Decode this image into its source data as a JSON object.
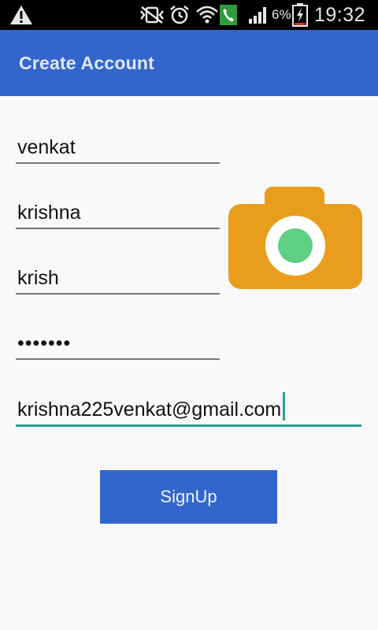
{
  "status_bar": {
    "time": "19:32",
    "battery_percent": "6%",
    "icons": [
      "warning-icon",
      "vibrate-muted-icon",
      "alarm-icon",
      "wifi-icon",
      "call-icon",
      "signal-icon",
      "battery-charging-icon"
    ]
  },
  "app_bar": {
    "title": "Create Account"
  },
  "form": {
    "first_name": "venkat",
    "last_name": "krishna",
    "username": "krish",
    "password_masked": "•••••••",
    "email": "krishna225venkat@gmail.com",
    "submit_label": "SignUp"
  },
  "photo": {
    "icon": "camera-icon",
    "body_color": "#e89e1c",
    "lens_color": "#5ecf85"
  },
  "colors": {
    "primary": "#3366cc",
    "accent": "#2a9d8f"
  }
}
